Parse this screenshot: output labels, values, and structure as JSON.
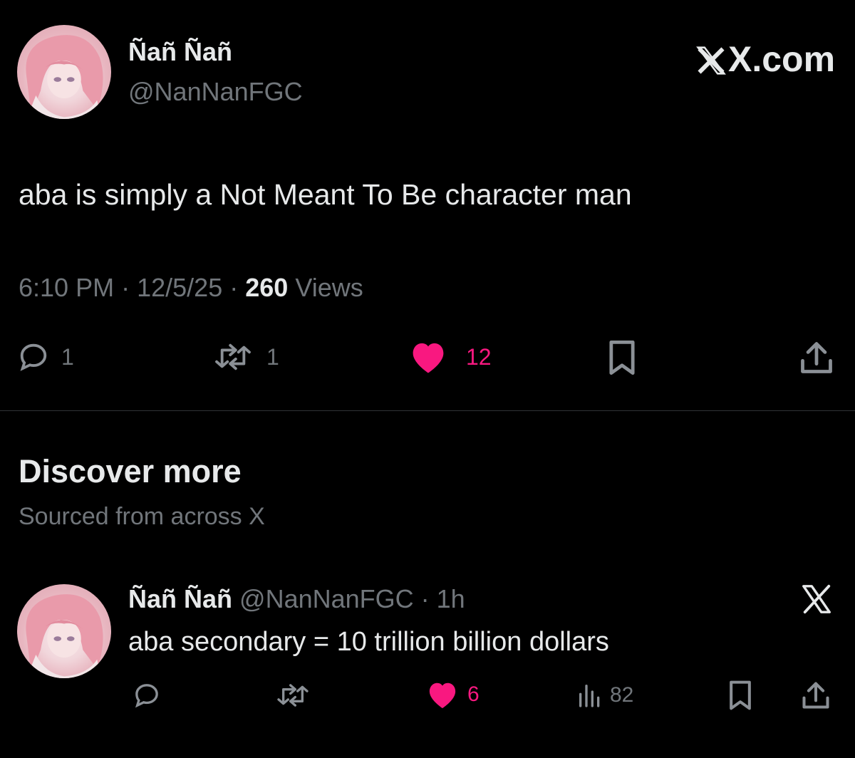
{
  "main_tweet": {
    "display_name": "Ñañ Ñañ",
    "handle": "@NanNanFGC",
    "site_label": "X.com",
    "text": "aba is simply a Not Meant To Be character man",
    "time": "6:10 PM",
    "date": "12/5/25",
    "separator": "·",
    "views_count": "260",
    "views_label": "Views",
    "actions": {
      "replies": "1",
      "reposts": "1",
      "likes": "12"
    }
  },
  "discover": {
    "title": "Discover more",
    "subtitle": "Sourced from across X"
  },
  "suggested_tweet": {
    "display_name": "Ñañ Ñañ",
    "handle_time": "@NanNanFGC · 1h",
    "text": "aba secondary = 10 trillion billion dollars",
    "actions": {
      "likes": "6",
      "views": "82"
    }
  },
  "colors": {
    "background": "#000000",
    "text": "#e7e9ea",
    "muted": "#71767b",
    "like": "#f91880"
  },
  "icons": [
    "reply-icon",
    "repost-icon",
    "heart-icon",
    "bookmark-icon",
    "share-icon",
    "views-icon",
    "x-logo-icon"
  ]
}
